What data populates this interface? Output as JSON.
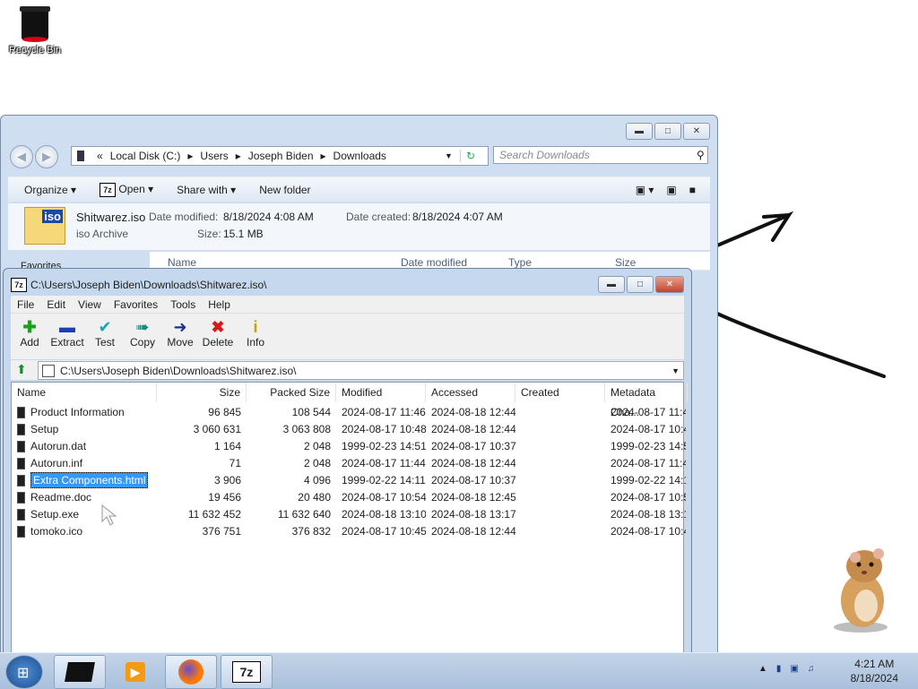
{
  "desktop": {
    "recycle_bin_label": "Recycle Bin"
  },
  "explorer": {
    "breadcrumb": [
      "Local Disk (C:)",
      "Users",
      "Joseph Biden",
      "Downloads"
    ],
    "search_placeholder": "Search Downloads",
    "commands": {
      "organize": "Organize",
      "open": "Open",
      "share_with": "Share with",
      "new_folder": "New folder"
    },
    "details": {
      "filename": "Shitwarez.iso",
      "type": "iso Archive",
      "date_modified_label": "Date modified:",
      "date_modified": "8/18/2024 4:08 AM",
      "date_created_label": "Date created:",
      "date_created": "8/18/2024 4:07 AM",
      "size_label": "Size:",
      "size": "15.1 MB",
      "icon_text": "iso"
    },
    "nav_partial": "Favorites",
    "columns": [
      "Name",
      "Date modified",
      "Type",
      "Size"
    ]
  },
  "sevenzip": {
    "title": "C:\\Users\\Joseph Biden\\Downloads\\Shitwarez.iso\\",
    "menu": [
      "File",
      "Edit",
      "View",
      "Favorites",
      "Tools",
      "Help"
    ],
    "toolbar": [
      "Add",
      "Extract",
      "Test",
      "Copy",
      "Move",
      "Delete",
      "Info"
    ],
    "path": "C:\\Users\\Joseph Biden\\Downloads\\Shitwarez.iso\\",
    "columns": [
      "Name",
      "Size",
      "Packed Size",
      "Modified",
      "Accessed",
      "Created",
      "Metadata Cha..."
    ],
    "files": [
      {
        "name": "Product Information",
        "size": "96 845",
        "packed": "108 544",
        "modified": "2024-08-17 11:46",
        "accessed": "2024-08-18 12:44",
        "created": "",
        "meta": "2024-08-17 11:4"
      },
      {
        "name": "Setup",
        "size": "3 060 631",
        "packed": "3 063 808",
        "modified": "2024-08-17 10:48",
        "accessed": "2024-08-18 12:44",
        "created": "",
        "meta": "2024-08-17 10:4"
      },
      {
        "name": "Autorun.dat",
        "size": "1 164",
        "packed": "2 048",
        "modified": "1999-02-23 14:51",
        "accessed": "2024-08-17 10:37",
        "created": "",
        "meta": "1999-02-23 14:5"
      },
      {
        "name": "Autorun.inf",
        "size": "71",
        "packed": "2 048",
        "modified": "2024-08-17 11:44",
        "accessed": "2024-08-18 12:44",
        "created": "",
        "meta": "2024-08-17 11:4"
      },
      {
        "name": "Extra Components.html",
        "size": "3 906",
        "packed": "4 096",
        "modified": "1999-02-22 14:11",
        "accessed": "2024-08-17 10:37",
        "created": "",
        "meta": "1999-02-22 14:1"
      },
      {
        "name": "Readme.doc",
        "size": "19 456",
        "packed": "20 480",
        "modified": "2024-08-17 10:54",
        "accessed": "2024-08-18 12:45",
        "created": "",
        "meta": "2024-08-17 10:5"
      },
      {
        "name": "Setup.exe",
        "size": "11 632 452",
        "packed": "11 632 640",
        "modified": "2024-08-18 13:10",
        "accessed": "2024-08-18 13:17",
        "created": "",
        "meta": "2024-08-18 13:1"
      },
      {
        "name": "tomoko.ico",
        "size": "376 751",
        "packed": "376 832",
        "modified": "2024-08-17 10:45",
        "accessed": "2024-08-18 12:44",
        "created": "",
        "meta": "2024-08-17 10:4"
      }
    ],
    "selected_file": "Extra Components.html"
  },
  "taskbar": {
    "start_icon": "windows-orb-icon",
    "pinned": [
      "black-box-icon",
      "media-player-icon",
      "firefox-icon",
      "7zip-icon"
    ],
    "time": "4:21 AM",
    "date": "8/18/2024"
  }
}
